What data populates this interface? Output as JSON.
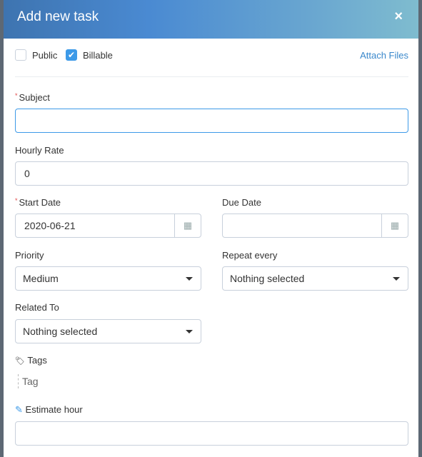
{
  "header": {
    "title": "Add new task",
    "close": "×"
  },
  "options": {
    "public": {
      "label": "Public",
      "checked": false
    },
    "billable": {
      "label": "Billable",
      "checked": true
    },
    "attach_files": "Attach Files"
  },
  "form": {
    "subject": {
      "label": "Subject",
      "value": ""
    },
    "hourly_rate": {
      "label": "Hourly Rate",
      "value": "0"
    },
    "start_date": {
      "label": "Start Date",
      "value": "2020-06-21"
    },
    "due_date": {
      "label": "Due Date",
      "value": ""
    },
    "priority": {
      "label": "Priority",
      "value": "Medium"
    },
    "repeat_every": {
      "label": "Repeat every",
      "value": "Nothing selected"
    },
    "related_to": {
      "label": "Related To",
      "value": "Nothing selected"
    },
    "tags": {
      "label": "Tags",
      "placeholder": "Tag"
    },
    "estimate_hour": {
      "label": "Estimate hour",
      "value": ""
    }
  },
  "colors": {
    "accent": "#3d9ae8",
    "required": "#e04848"
  }
}
